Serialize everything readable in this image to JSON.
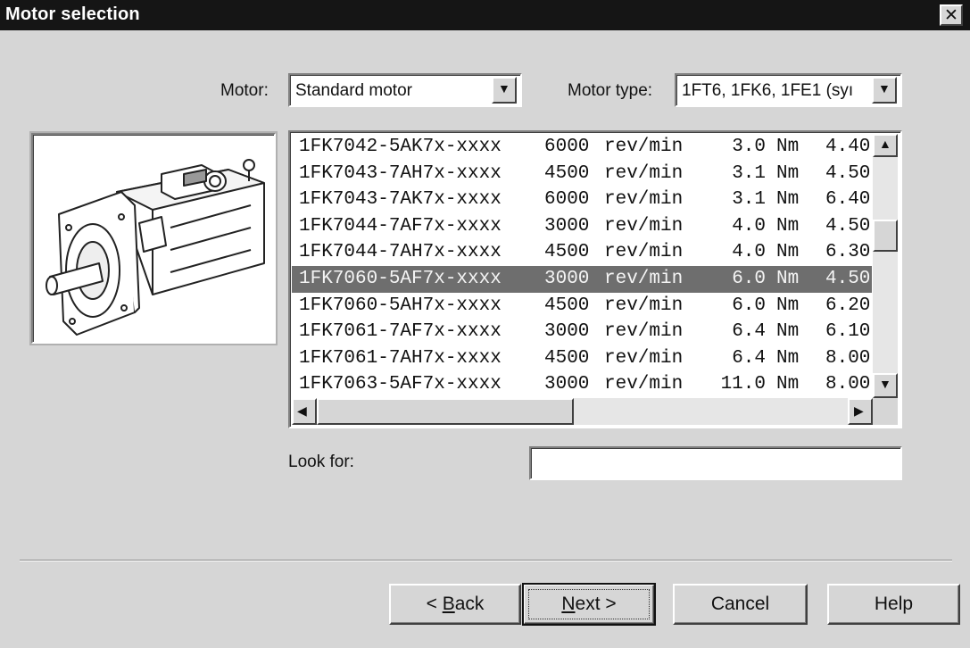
{
  "window": {
    "title": "Motor selection",
    "close_symbol": "✕"
  },
  "motor": {
    "label": "Motor:",
    "value": "Standard motor"
  },
  "motor_type": {
    "label": "Motor type:",
    "value": "1FT6, 1FK6, 1FE1 (syı"
  },
  "image": {
    "icon": "servo-motor-icon"
  },
  "motor_list": {
    "selected_index": 5,
    "rows": [
      {
        "part": "1FK7042-5AK7x-xxxx",
        "speed": "6000",
        "speed_unit": "rev/min",
        "torque": "3.0",
        "torque_unit": "Nm",
        "extra": "4.40"
      },
      {
        "part": "1FK7043-7AH7x-xxxx",
        "speed": "4500",
        "speed_unit": "rev/min",
        "torque": "3.1",
        "torque_unit": "Nm",
        "extra": "4.50"
      },
      {
        "part": "1FK7043-7AK7x-xxxx",
        "speed": "6000",
        "speed_unit": "rev/min",
        "torque": "3.1",
        "torque_unit": "Nm",
        "extra": "6.40"
      },
      {
        "part": "1FK7044-7AF7x-xxxx",
        "speed": "3000",
        "speed_unit": "rev/min",
        "torque": "4.0",
        "torque_unit": "Nm",
        "extra": "4.50"
      },
      {
        "part": "1FK7044-7AH7x-xxxx",
        "speed": "4500",
        "speed_unit": "rev/min",
        "torque": "4.0",
        "torque_unit": "Nm",
        "extra": "6.30"
      },
      {
        "part": "1FK7060-5AF7x-xxxx",
        "speed": "3000",
        "speed_unit": "rev/min",
        "torque": "6.0",
        "torque_unit": "Nm",
        "extra": "4.50"
      },
      {
        "part": "1FK7060-5AH7x-xxxx",
        "speed": "4500",
        "speed_unit": "rev/min",
        "torque": "6.0",
        "torque_unit": "Nm",
        "extra": "6.20"
      },
      {
        "part": "1FK7061-7AF7x-xxxx",
        "speed": "3000",
        "speed_unit": "rev/min",
        "torque": "6.4",
        "torque_unit": "Nm",
        "extra": "6.10"
      },
      {
        "part": "1FK7061-7AH7x-xxxx",
        "speed": "4500",
        "speed_unit": "rev/min",
        "torque": "6.4",
        "torque_unit": "Nm",
        "extra": "8.00"
      },
      {
        "part": "1FK7063-5AF7x-xxxx",
        "speed": "3000",
        "speed_unit": "rev/min",
        "torque": "11.0",
        "torque_unit": "Nm",
        "extra": "8.00"
      }
    ]
  },
  "look_for": {
    "label": "Look for:",
    "value": ""
  },
  "buttons": {
    "back": {
      "prefix": "< ",
      "mnemonic": "B",
      "rest": "ack"
    },
    "next": {
      "mnemonic": "N",
      "rest": "ext >"
    },
    "cancel": "Cancel",
    "help": "Help"
  },
  "scroll_glyphs": {
    "up": "▲",
    "down": "▼",
    "left": "◀",
    "right": "▶"
  }
}
